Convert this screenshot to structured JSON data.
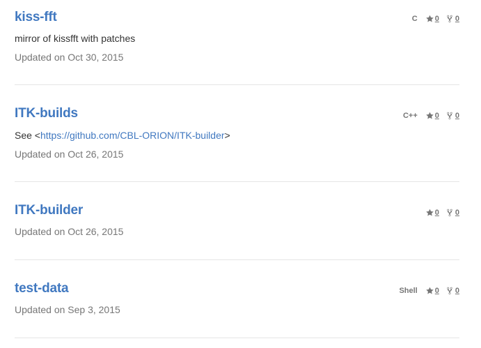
{
  "repos": [
    {
      "name": "kiss-fft",
      "description": "mirror of kissfft with patches",
      "updated": "Updated on Oct 30, 2015",
      "language": "C",
      "stars": "0",
      "forks": "0"
    },
    {
      "name": "ITK-builds",
      "description_prefix": "See <",
      "description_link": "https://github.com/CBL-ORION/ITK-builder",
      "description_suffix": ">",
      "updated": "Updated on Oct 26, 2015",
      "language": "C++",
      "stars": "0",
      "forks": "0"
    },
    {
      "name": "ITK-builder",
      "updated": "Updated on Oct 26, 2015",
      "stars": "0",
      "forks": "0"
    },
    {
      "name": "test-data",
      "updated": "Updated on Sep 3, 2015",
      "language": "Shell",
      "stars": "0",
      "forks": "0"
    }
  ],
  "colors": {
    "link": "#4078c0",
    "muted": "#767676",
    "divider": "#e5e5e5"
  },
  "icons": {
    "star": "star-icon",
    "fork": "fork-icon"
  }
}
